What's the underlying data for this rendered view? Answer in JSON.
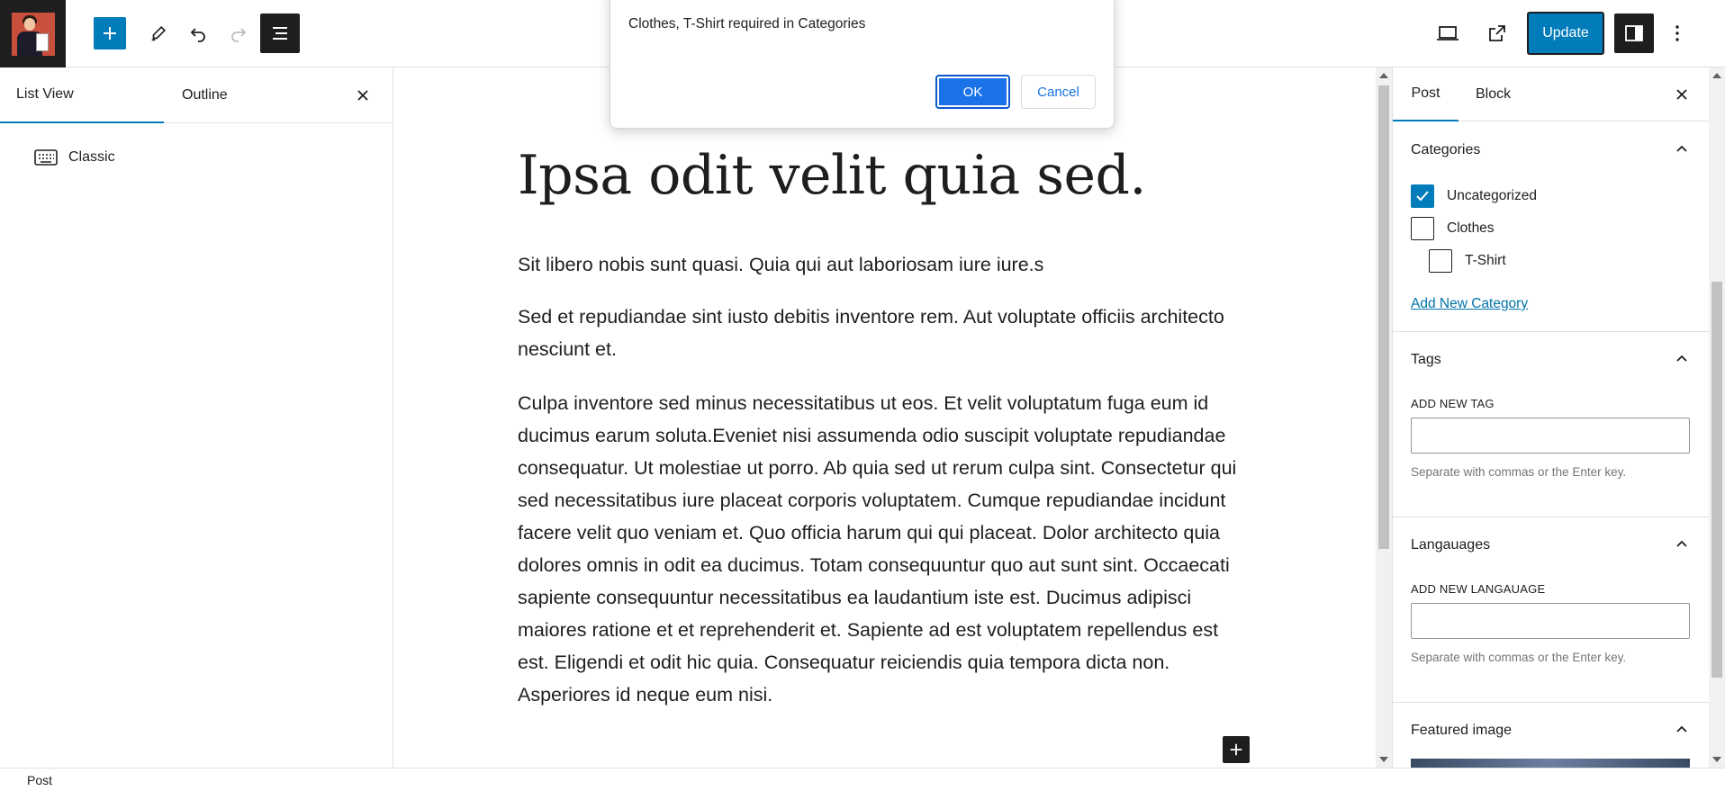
{
  "toolbar": {
    "update_label": "Update"
  },
  "left_panel": {
    "tabs": [
      {
        "label": "List View"
      },
      {
        "label": "Outline"
      }
    ],
    "list_items": [
      {
        "label": "Classic"
      }
    ]
  },
  "post": {
    "title": "Ipsa odit velit quia sed.",
    "paragraphs": [
      "Sit libero nobis sunt quasi. Quia qui aut laboriosam iure iure.s",
      "Sed et repudiandae sint iusto debitis inventore rem. Aut voluptate officiis architecto nesciunt et.",
      "Culpa inventore sed minus necessitatibus ut eos. Et velit voluptatum fuga eum id ducimus earum soluta.Eveniet nisi assumenda odio suscipit voluptate repudiandae consequatur. Ut molestiae ut porro. Ab quia sed ut rerum culpa sint. Consectetur qui sed necessitatibus iure placeat corporis voluptatem. Cumque repudiandae incidunt facere velit quo veniam et. Quo officia harum qui qui placeat. Dolor architecto quia dolores omnis in odit ea ducimus. Totam consequuntur quo aut sunt sint. Occaecati sapiente consequuntur necessitatibus ea laudantium iste est. Ducimus adipisci maiores ratione et et reprehenderit et. Sapiente ad est voluptatem repellendus est est. Eligendi et odit hic quia. Consequatur reiciendis quia tempora dicta non. Asperiores id neque eum nisi."
    ]
  },
  "sidebar": {
    "tabs": [
      {
        "label": "Post"
      },
      {
        "label": "Block"
      }
    ],
    "categories": {
      "title": "Categories",
      "items": [
        {
          "label": "Uncategorized",
          "checked": true
        },
        {
          "label": "Clothes",
          "checked": false
        },
        {
          "label": "T-Shirt",
          "checked": false
        }
      ],
      "add_link": "Add New Category"
    },
    "tags": {
      "title": "Tags",
      "field_label": "ADD NEW TAG",
      "value": "",
      "help": "Separate with commas or the Enter key."
    },
    "languages": {
      "title": "Langauages",
      "field_label": "ADD NEW LANGAUAGE",
      "value": "",
      "help": "Separate with commas or the Enter key."
    },
    "featured_image": {
      "title": "Featured image"
    }
  },
  "footer": {
    "breadcrumb": "Post"
  },
  "dialog": {
    "message": "Clothes, T-Shirt required in Categories",
    "ok_label": "OK",
    "cancel_label": "Cancel"
  },
  "colors": {
    "accent": "#007cba",
    "dark": "#1e1e1e",
    "dialog_primary": "#1a73e8"
  },
  "icons": [
    "site-logo",
    "plus-icon",
    "pen-icon",
    "undo-icon",
    "redo-icon",
    "document-overview-icon",
    "desktop-preview-icon",
    "external-link-icon",
    "sidebar-toggle-icon",
    "more-vertical-icon",
    "close-icon",
    "keyboard-icon",
    "chevron-up-icon",
    "check-icon"
  ]
}
